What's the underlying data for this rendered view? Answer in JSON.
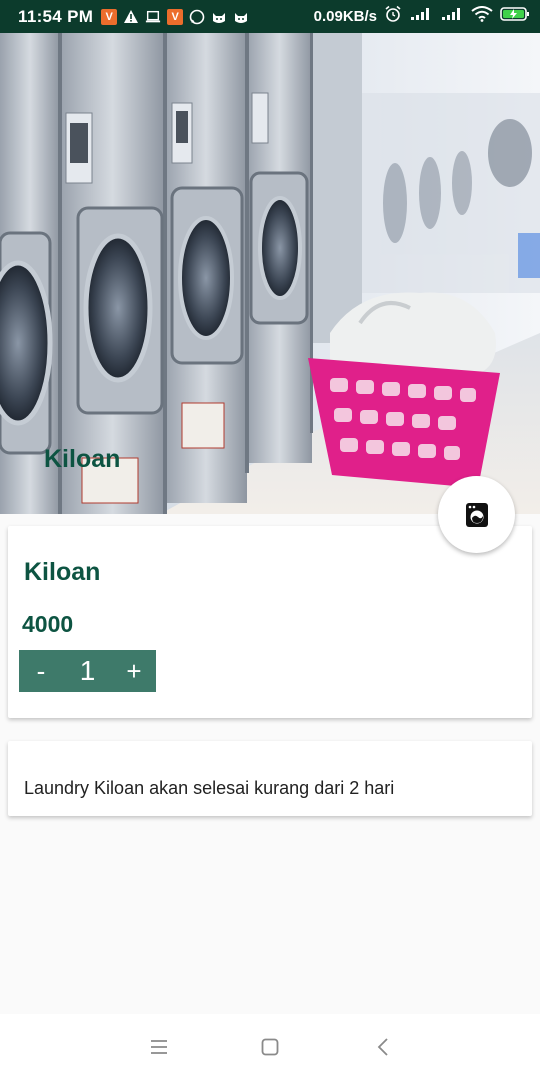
{
  "status_bar": {
    "time": "11:54 PM",
    "net_speed": "0.09KB/s",
    "notification_icons": [
      "vpn-v-icon",
      "warning-icon",
      "laptop-icon",
      "vpn-v-icon",
      "whatsapp-icon",
      "cat-icon",
      "cat-icon"
    ],
    "system_icons": [
      "alarm-icon",
      "signal-icon",
      "signal-icon",
      "wifi-icon",
      "battery-charging-icon"
    ]
  },
  "hero": {
    "title": "Kiloan",
    "image": "laundromat-washing-machines-and-pink-basket"
  },
  "fab": {
    "icon": "washing-machine-icon"
  },
  "product": {
    "name": "Kiloan",
    "price": "4000",
    "quantity": "1",
    "decrement_label": "-",
    "increment_label": "+"
  },
  "info": {
    "text": "Laundry Kiloan akan selesai kurang dari 2 hari"
  },
  "colors": {
    "status_bar": "#0c3b2c",
    "primary_text": "#0d5442",
    "stepper": "#3e7a6a",
    "basket": "#e0208a"
  },
  "nav": {
    "buttons": [
      "menu-icon",
      "home-square-icon",
      "back-icon"
    ]
  }
}
